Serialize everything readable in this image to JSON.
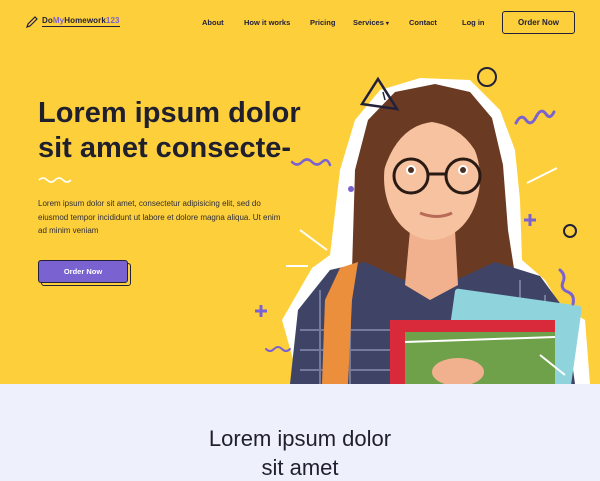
{
  "header": {
    "logo_prefix": "Do",
    "logo_accent": "My",
    "logo_mid": "Homework",
    "logo_suffix": "123",
    "nav": {
      "about": "About",
      "how": "How it works",
      "pricing": "Pricing",
      "services": "Services",
      "contact": "Contact",
      "login": "Log in"
    },
    "order_now": "Order Now"
  },
  "hero": {
    "title": "Lorem ipsum dolor sit amet consecte-",
    "text": "Lorem ipsum dolor sit amet, consectetur adipisicing elit, sed do eiusmod tempor incididunt ut labore et dolore magna aliqua. Ut enim ad minim veniam",
    "cta_label": "Order Now"
  },
  "section2": {
    "title_line1": "Lorem ipsum dolor",
    "title_line2": "sit amet"
  },
  "colors": {
    "hero_bg": "#fdcf3a",
    "accent": "#7b62d1",
    "dark": "#23213a",
    "section_bg": "#eef0fb"
  },
  "icons": [
    "pencil-icon",
    "chevron-down-icon",
    "squiggle-decoration",
    "triangle-decoration",
    "circle-decoration",
    "plus-decoration",
    "student-illustration"
  ]
}
